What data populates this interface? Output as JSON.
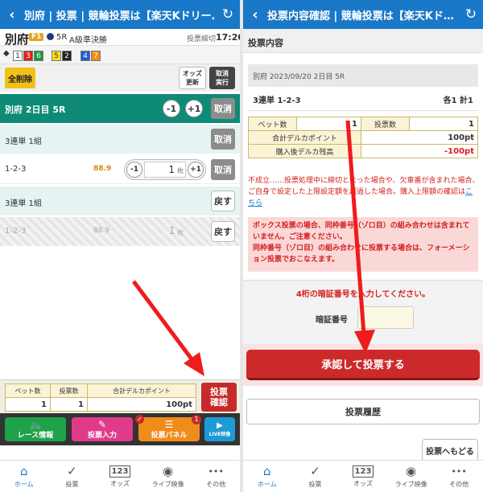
{
  "left": {
    "header": {
      "title": "別府 | 投票 | 競輪投票は【楽天Kドリー…"
    },
    "race": {
      "venue": "別府",
      "grade": "F1",
      "race_no": "5R",
      "race_name": "A級準決勝",
      "deadline_label": "投票締切",
      "deadline_time": "17:20"
    },
    "lines": {
      "arrow": "◆",
      "groups": [
        [
          "1",
          "3",
          "6"
        ],
        [
          "5",
          "2"
        ],
        [
          "4",
          "7"
        ]
      ]
    },
    "actions": {
      "clear_all": "全削除",
      "odds_update": "オッズ\n更新",
      "cancel_exec": "取消\n実行"
    },
    "race_section": {
      "title": "別府 2日目 5R",
      "minus": "-1",
      "plus": "+1",
      "cancel": "取消"
    },
    "bet1": {
      "label": "3連単 1組",
      "cancel": "取消"
    },
    "row1": {
      "combo": "1-2-3",
      "odds": "88.9",
      "minus": "-1",
      "amount": "1",
      "unit": "枚",
      "plus": "+1",
      "cancel": "取消"
    },
    "bet2": {
      "label": "3連単 1組",
      "back": "戻す"
    },
    "row2": {
      "combo": "1-2-3",
      "odds": "88.9",
      "amount": "1",
      "unit": "枚",
      "back": "戻す"
    },
    "summary": {
      "bets_header": "ベット数",
      "votes_header": "投票数",
      "points_header": "合計デルカポイント",
      "bets": "1",
      "votes": "1",
      "points": "100pt",
      "confirm": "投票\n確認"
    },
    "quick": {
      "race_info": "レース情報",
      "vote_input": "投票入力",
      "vote_panel": "投票パネル",
      "panel_badge": "1",
      "live": "LIVE映像"
    },
    "nav": [
      {
        "icon": "⌂",
        "label": "ホーム"
      },
      {
        "icon": "✓",
        "label": "投票"
      },
      {
        "icon": "123",
        "label": "オッズ"
      },
      {
        "icon": "◉",
        "label": "ライブ映像"
      },
      {
        "icon": "•••",
        "label": "その他"
      }
    ]
  },
  "right": {
    "header": {
      "title": "投票内容確認 | 競輪投票は【楽天Kド…"
    },
    "section_title": "投票内容",
    "detail": {
      "race": "別府 2023/09/20 2日目 5R",
      "combo": "3連単 1-2-3",
      "count": "各1 計1"
    },
    "table": {
      "bets_label": "ベット数",
      "bets": "1",
      "votes_label": "投票数",
      "votes": "1",
      "points_label": "合計デルカポイント",
      "points": "100pt",
      "balance_label": "購入後デルカ残高",
      "balance": "-100pt"
    },
    "notice": "不成立……投票処理中に締切となった場合や、欠車番が含まれた場合、ご自身で設定した上限設定額を超過した場合。購入上限額の確認は",
    "notice_link": "こちら",
    "warning": "ボックス投票の場合、同枠番号（ゾロ目）の組み合わせは含まれていません。ご注意ください。\n同枠番号（ゾロ目）の組み合わせに投票する場合は、フォーメーション投票でおこなえます。",
    "pin_prompt": "4桁の暗証番号を入力してください。",
    "pin_label": "暗証番号",
    "pin_value": "",
    "submit": "承認して投票する",
    "history": "投票履歴",
    "back_to_vote": "投票へもどる",
    "nav": [
      {
        "icon": "⌂",
        "label": "ホーム"
      },
      {
        "icon": "✓",
        "label": "投票"
      },
      {
        "icon": "123",
        "label": "オッズ"
      },
      {
        "icon": "◉",
        "label": "ライブ映像"
      },
      {
        "icon": "•••",
        "label": "その他"
      }
    ]
  },
  "colors": {
    "header_blue": "#1a78c8",
    "teal": "#0f8a76",
    "red": "#d42020",
    "arrow": "#ee1c1c"
  }
}
